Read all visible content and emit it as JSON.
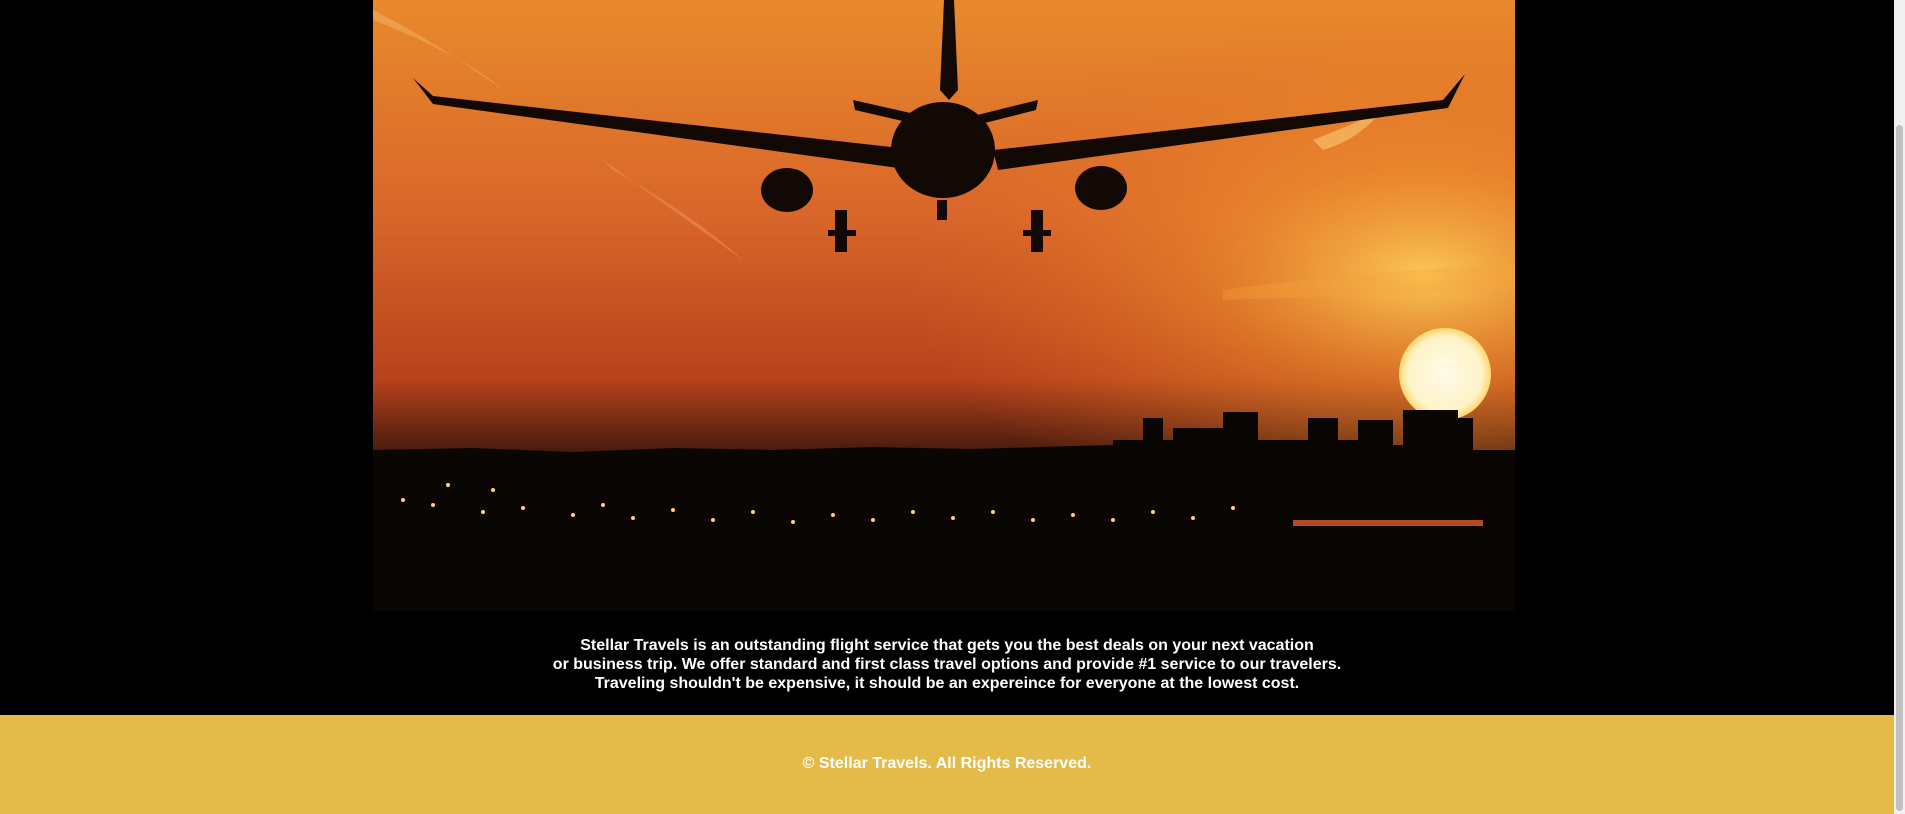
{
  "hero": {
    "image_icon": "airplane-landing-sunset-image"
  },
  "description": {
    "lines": [
      "Stellar Travels is an outstanding flight service that gets you the best deals on your next vacation",
      "or business trip. We offer standard and first class travel options and provide #1 service to our travelers.",
      "Traveling shouldn't be expensive, it should be an expereince for everyone at the lowest cost."
    ]
  },
  "footer": {
    "copyright": "© Stellar Travels. All Rights Reserved."
  },
  "colors": {
    "page_background": "#000000",
    "footer_background": "#e4bb48",
    "text": "#ffffff",
    "sky_top": "#e4892c",
    "sky_bottom": "#b43d14"
  }
}
